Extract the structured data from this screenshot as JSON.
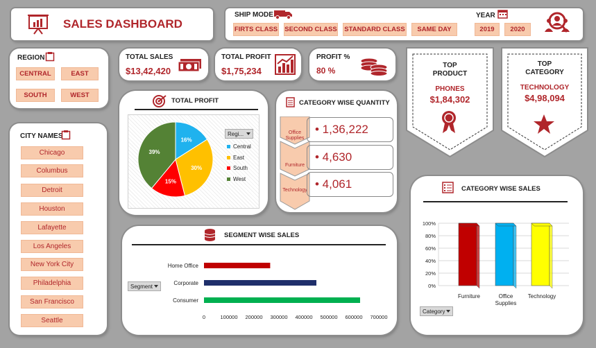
{
  "header": {
    "title": "SALES DASHBOARD"
  },
  "ship_mode": {
    "label": "SHIP MODE",
    "options": [
      "FIRTS CLASS",
      "SECOND CLASS",
      "STANDARD CLASS",
      "SAME DAY"
    ]
  },
  "year": {
    "label": "YEAR",
    "options": [
      "2019",
      "2020"
    ]
  },
  "region": {
    "label": "REGION",
    "options": [
      "CENTRAL",
      "EAST",
      "SOUTH",
      "WEST"
    ]
  },
  "kpis": {
    "total_sales": {
      "label": "TOTAL SALES",
      "value": "$13,42,420"
    },
    "total_profit": {
      "label": "TOTAL PROFIT",
      "value": "$1,75,234"
    },
    "profit_pct": {
      "label": "PROFIT %",
      "value": "80 %"
    }
  },
  "top_product": {
    "line1": "TOP",
    "line2": "PRODUCT",
    "name": "PHONES",
    "value": "$1,84,302"
  },
  "top_category": {
    "line1": "TOP",
    "line2": "CATEGORY",
    "name": "TECHNOLOGY",
    "value": "$4,98,094"
  },
  "city": {
    "label": "CITY NAMES",
    "items": [
      "Chicago",
      "Columbus",
      "Detroit",
      "Houston",
      "Lafayette",
      "Los Angeles",
      "New York City",
      "Philadelphia",
      "San Francisco",
      "Seattle"
    ]
  },
  "total_profit_pie": {
    "title": "TOTAL PROFIT",
    "filter": "Regi...",
    "legend": [
      "Central",
      "East",
      "South",
      "West"
    ]
  },
  "category_qty": {
    "title": "CATEGORY WISE QUANTITY",
    "labels": [
      "Office Supplies",
      "Furniture",
      "Technology"
    ],
    "values": [
      "• 1,36,222",
      "• 4,630",
      "• 4,061"
    ]
  },
  "segment_sales": {
    "title": "SEGMENT WISE SALES",
    "filter": "Segment"
  },
  "category_sales": {
    "title": "CATEGORY WISE SALES",
    "filter": "Category"
  },
  "colors": {
    "accent": "#b0262b",
    "button": "#f8cbad",
    "background": "#a3a3a3"
  },
  "chart_data": [
    {
      "type": "pie",
      "title": "TOTAL PROFIT",
      "categories": [
        "Central",
        "East",
        "South",
        "West"
      ],
      "values": [
        16,
        30,
        15,
        39
      ],
      "labels": [
        "16%",
        "30%",
        "15%",
        "39%"
      ],
      "colors": [
        "#1fb2ee",
        "#ffc000",
        "#ff0000",
        "#548235"
      ],
      "legend": "right"
    },
    {
      "type": "bar",
      "orientation": "horizontal",
      "title": "SEGMENT WISE SALES",
      "categories": [
        "Home Office",
        "Corporate",
        "Consumer"
      ],
      "values": [
        265000,
        450000,
        625000
      ],
      "colors": [
        "#c00000",
        "#1f2f6b",
        "#00b050"
      ],
      "xlim": [
        0,
        700000
      ],
      "ticks": [
        "0",
        "100000",
        "200000",
        "300000",
        "400000",
        "500000",
        "600000",
        "700000"
      ],
      "grid": false
    },
    {
      "type": "bar",
      "title": "CATEGORY WISE SALES",
      "categories": [
        "Furniture",
        "Office Supplies",
        "Technology"
      ],
      "values": [
        100,
        100,
        100
      ],
      "colors": [
        "#c00000",
        "#00b0f0",
        "#ffff00"
      ],
      "ylim": [
        0,
        100
      ],
      "ticks": [
        "0%",
        "20%",
        "40%",
        "60%",
        "80%",
        "100%"
      ],
      "grid": true
    }
  ]
}
